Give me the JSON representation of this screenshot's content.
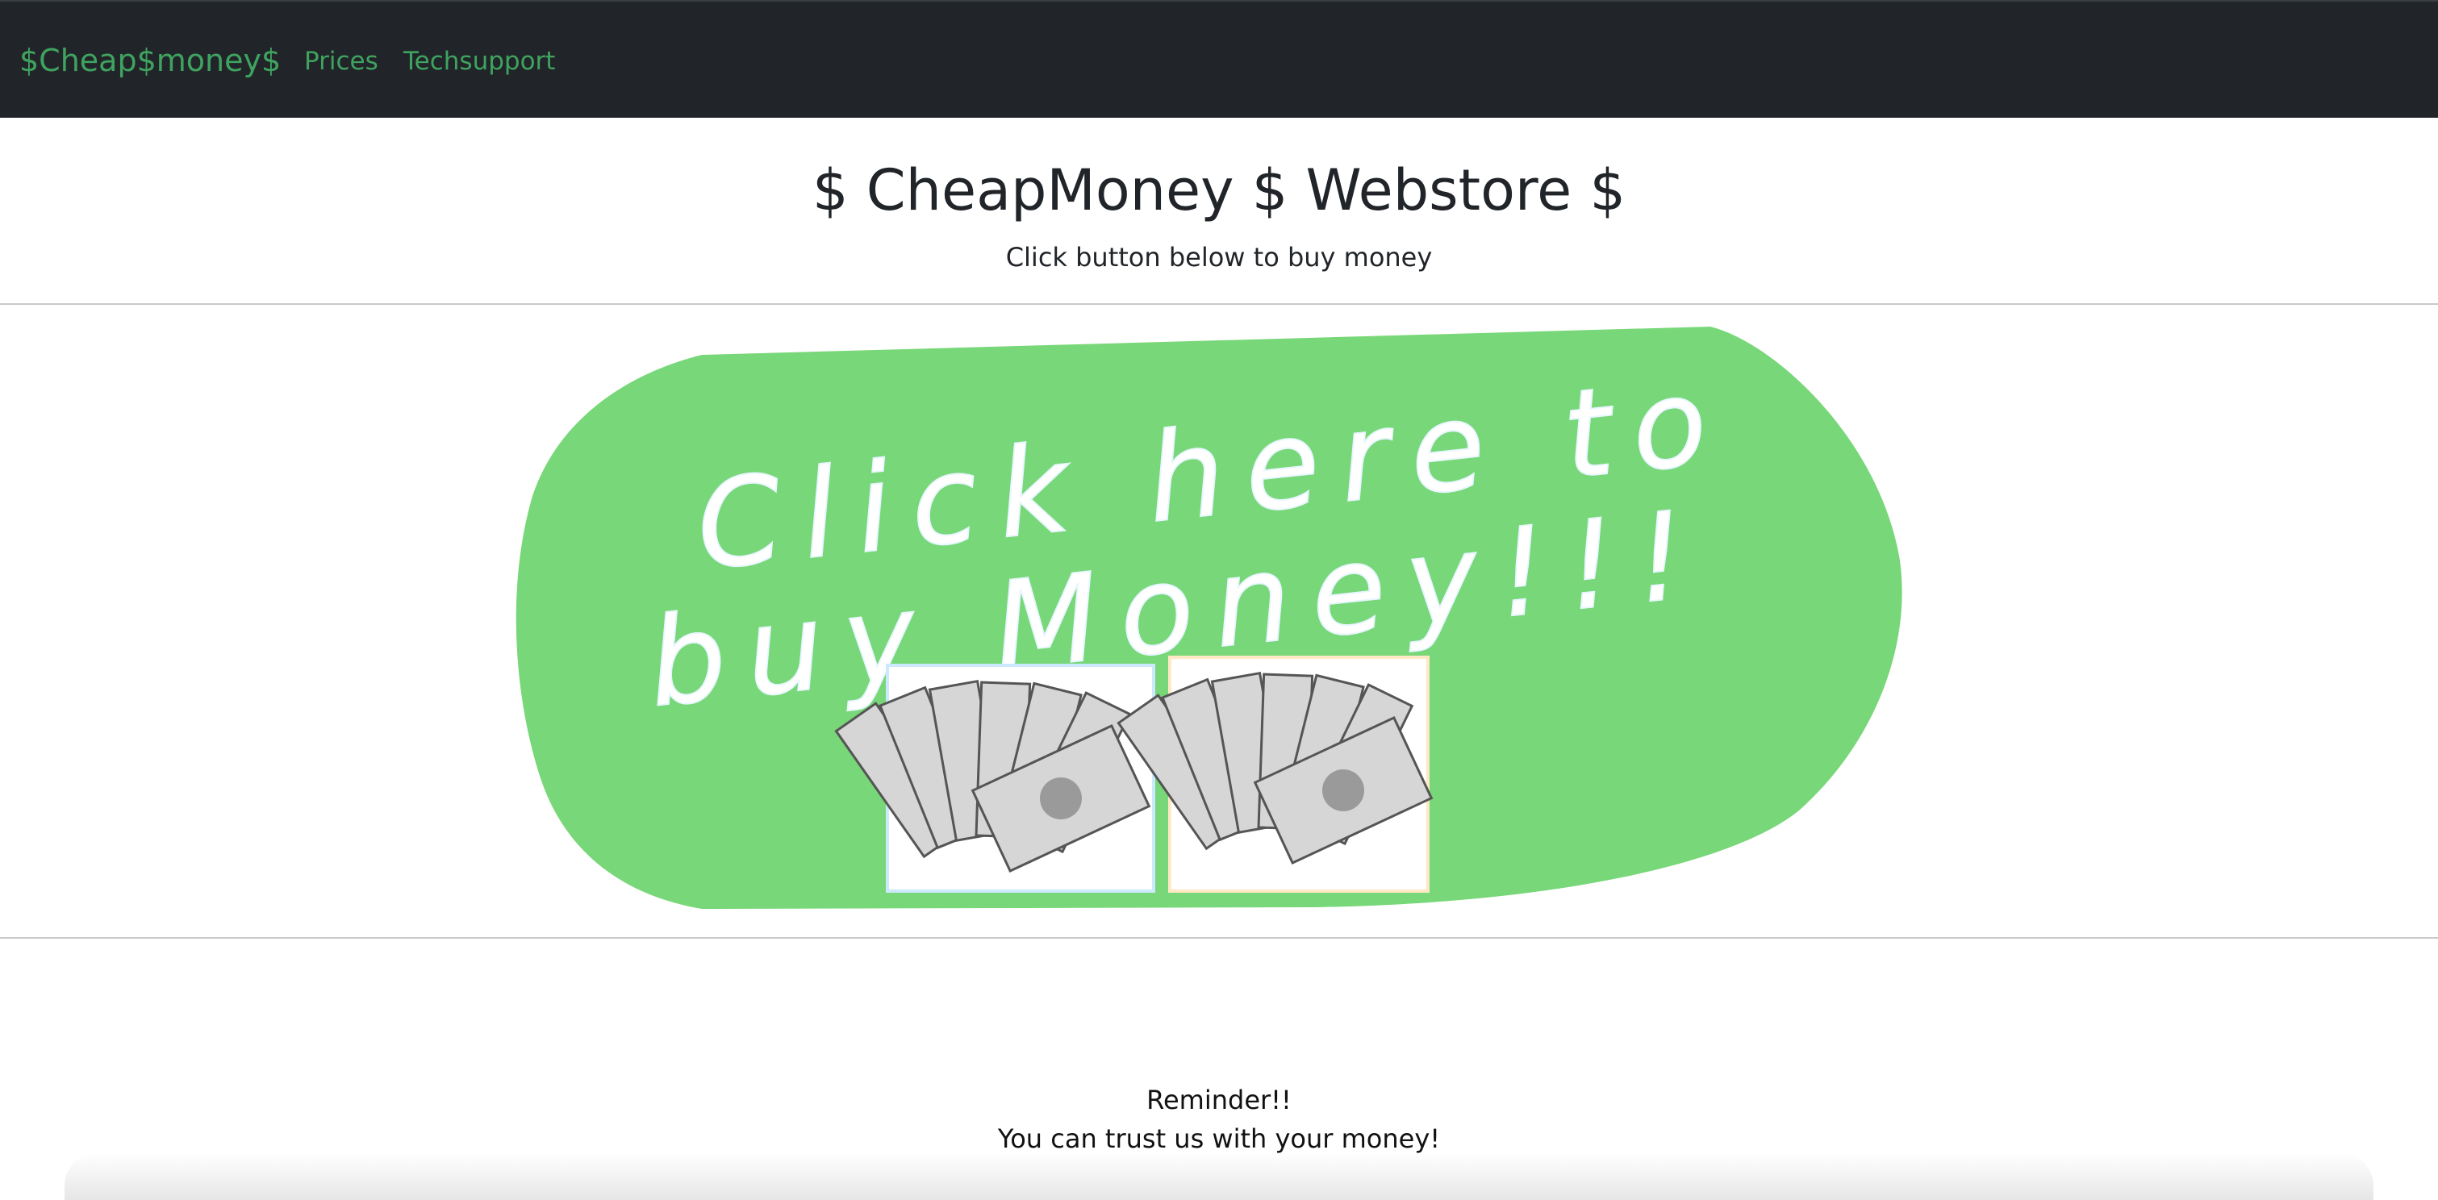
{
  "navbar": {
    "brand": "$Cheap$money$",
    "links": [
      {
        "label": "Prices"
      },
      {
        "label": "Techsupport"
      }
    ]
  },
  "header": {
    "title": "$ CheapMoney $ Webstore $",
    "subtitle": "Click button below to buy money"
  },
  "banner": {
    "line1": "Click here to",
    "line2": "buy Money!!!",
    "color": "#78d778",
    "icons": [
      "money-fan-icon",
      "money-fan-icon"
    ]
  },
  "reminder": {
    "line1": "Reminder!!",
    "line2": "You can trust us with your money!"
  },
  "colors": {
    "navbar_bg": "#212529",
    "link": "#3fa35f",
    "banner_green": "#78d778"
  }
}
